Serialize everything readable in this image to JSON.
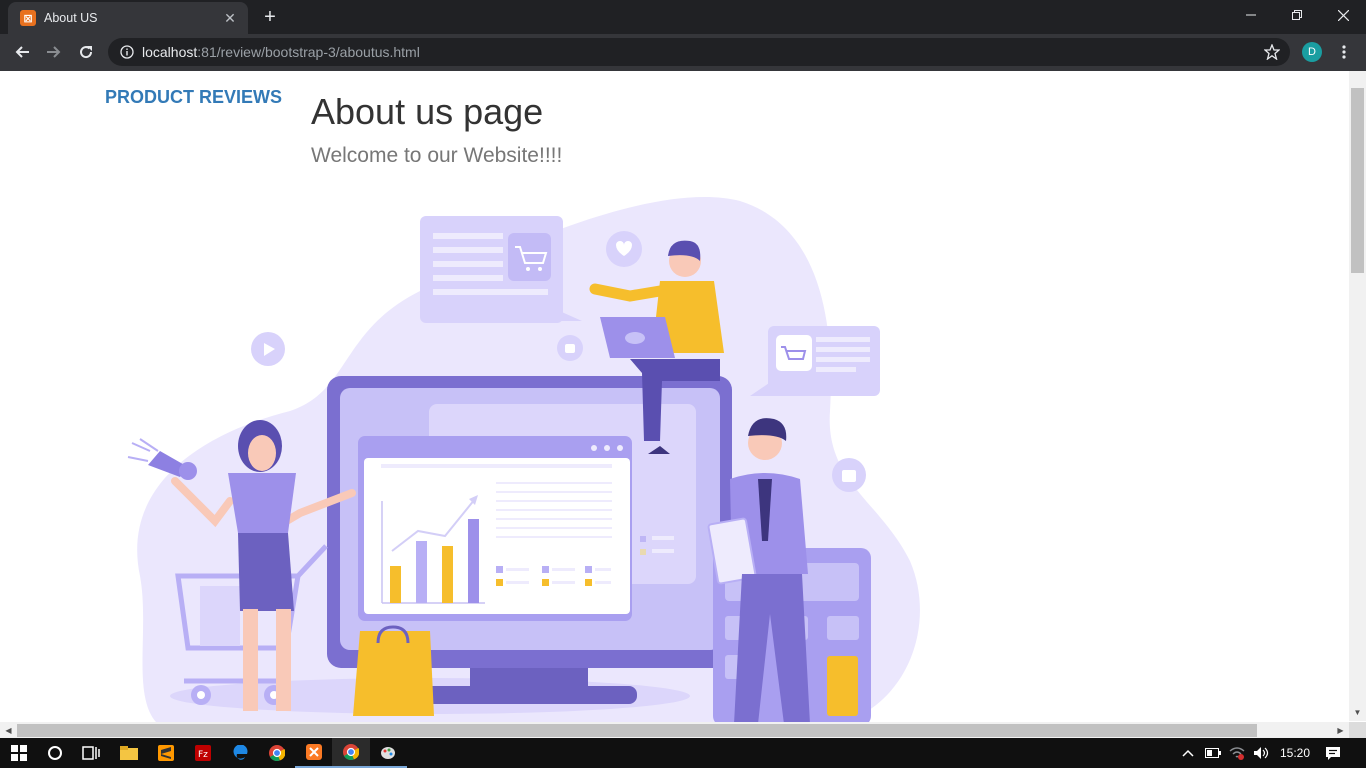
{
  "browser": {
    "tab_title": "About US",
    "tab_favicon": "xampp-icon",
    "url_host": "localhost",
    "url_rest": ":81/review/bootstrap-3/aboutus.html",
    "profile_initial": "D"
  },
  "page": {
    "brand": "PRODUCT REVIEWS",
    "heading": "About us page",
    "subheading": "Welcome to our Website!!!!",
    "illustration": "people-with-monitor-chart-shopping-illustration"
  },
  "colors": {
    "brand": "#337ab7",
    "purple": "#7b6fd0",
    "lavender": "#e3defb",
    "yellow": "#f6be2c"
  },
  "taskbar": {
    "clock": "15:20",
    "apps": [
      "windows-start-icon",
      "search-icon",
      "task-view-icon",
      "file-explorer-icon",
      "sublime-text-icon",
      "filezilla-icon",
      "edge-icon",
      "chrome-icon",
      "xampp-icon",
      "chrome-icon",
      "paint-icon"
    ]
  }
}
